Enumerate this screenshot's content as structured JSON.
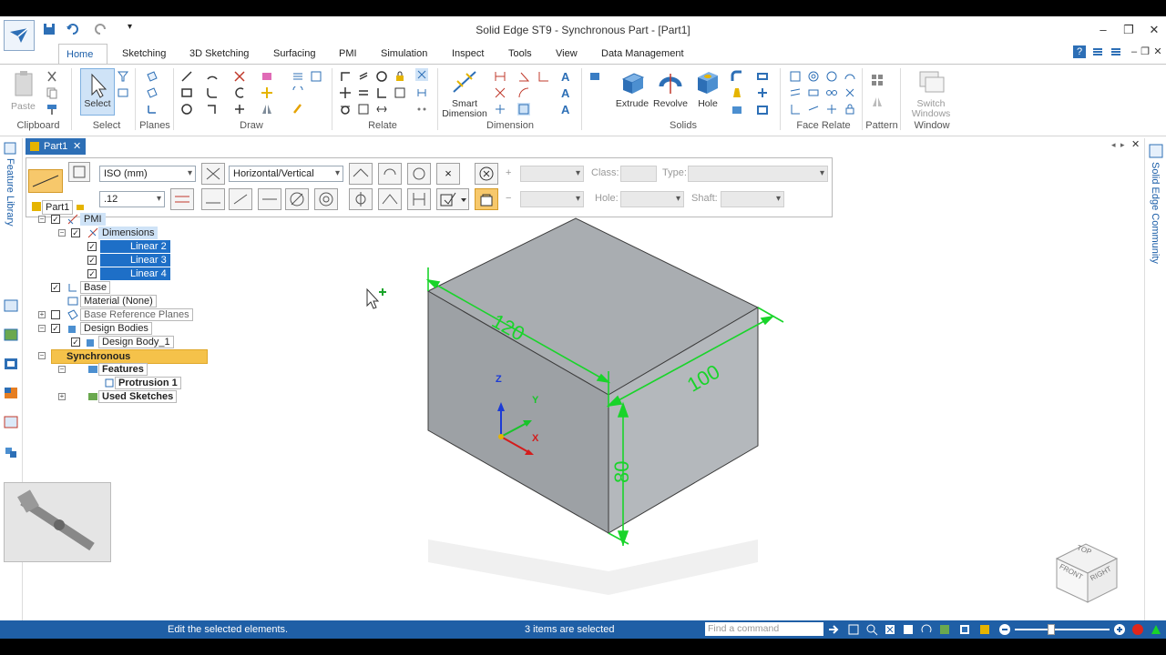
{
  "window": {
    "title": "Solid Edge ST9 - Synchronous Part - [Part1]"
  },
  "ribbon": {
    "tabs": [
      "Home",
      "Sketching",
      "3D Sketching",
      "Surfacing",
      "PMI",
      "Simulation",
      "Inspect",
      "Tools",
      "View",
      "Data Management"
    ],
    "active_tab": "Home",
    "groups": [
      "Clipboard",
      "Select",
      "Planes",
      "Draw",
      "Relate",
      "Dimension",
      "Solids",
      "Face Relate",
      "Pattern",
      "Window"
    ],
    "buttons": {
      "paste": "Paste",
      "select": "Select",
      "smart_dimension_1": "Smart",
      "smart_dimension_2": "Dimension",
      "extrude": "Extrude",
      "revolve": "Revolve",
      "hole": "Hole",
      "switch_windows_1": "Switch",
      "switch_windows_2": "Windows"
    }
  },
  "document_tab": "Part1",
  "left_panel_label": "Feature Library",
  "right_panel_label": "Solid Edge Community",
  "command_bar": {
    "standard": "ISO (mm)",
    "orientation": "Horizontal/Vertical",
    "precision": ".12",
    "class_label": "Class:",
    "type_label": "Type:",
    "hole_label": "Hole:",
    "shaft_label": "Shaft:",
    "plus": "+",
    "minus": "−",
    "close": "×"
  },
  "tree": {
    "part": "Part1",
    "pmi": "PMI",
    "dimensions": "Dimensions",
    "linear2": "Linear 2",
    "linear3": "Linear 3",
    "linear4": "Linear 4",
    "base": "Base",
    "material": "Material (None)",
    "base_planes": "Base Reference Planes",
    "design_bodies": "Design Bodies",
    "design_body_1": "Design Body_1",
    "synchronous": "Synchronous",
    "features": "Features",
    "protrusion": "Protrusion 1",
    "used_sketches": "Used Sketches"
  },
  "model": {
    "dim_width": "120",
    "dim_depth": "100",
    "dim_height": "80",
    "axis_x": "X",
    "axis_y": "Y",
    "axis_z": "Z",
    "cube_front": "FRONT",
    "cube_right": "RIGHT",
    "cube_top": "TOP"
  },
  "status": {
    "message": "Edit the selected elements.",
    "selection": "3 items are selected",
    "find_placeholder": "Find a command"
  },
  "colors": {
    "accent": "#1f5fa6",
    "dimension": "#19d42a",
    "solid_top": "#a9adb1",
    "solid_front": "#9da1a5",
    "solid_right": "#b4b8bc"
  }
}
